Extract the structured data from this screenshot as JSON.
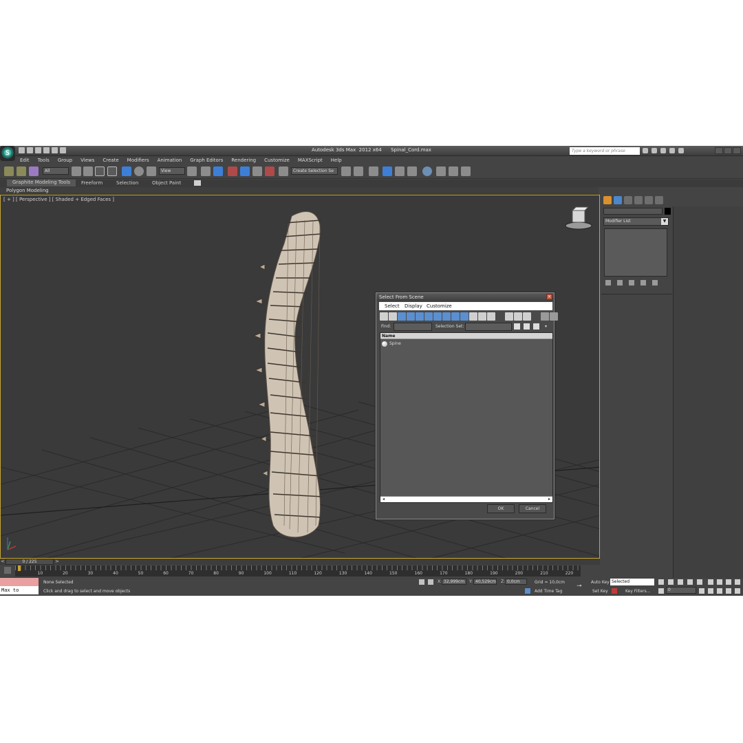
{
  "app": {
    "title": "Autodesk 3ds Max  2012 x64      Spinal_Cord.max",
    "logo_glyph": "S",
    "search_placeholder": "Type a keyword or phrase"
  },
  "menu": [
    "Edit",
    "Tools",
    "Group",
    "Views",
    "Create",
    "Modifiers",
    "Animation",
    "Graph Editors",
    "Rendering",
    "Customize",
    "MAXScript",
    "Help"
  ],
  "toolbar": {
    "selection_filter": "All",
    "reference_coord": "View",
    "named_selection_set": "Create Selection Se"
  },
  "ribbon": {
    "tabs": [
      "Graphite Modeling Tools",
      "Freeform",
      "Selection",
      "Object Paint"
    ],
    "active_tab": "Graphite Modeling Tools",
    "panel": "Polygon Modeling"
  },
  "viewport": {
    "label": "[ + ] [ Perspective ] [ Shaded + Edged Faces ]",
    "border_color": "#c9a532"
  },
  "command_panel": {
    "modifier_list": "Modifier List"
  },
  "dialog": {
    "title": "Select From Scene",
    "menu": [
      "Select",
      "Display",
      "Customize"
    ],
    "find_label": "Find:",
    "selection_set_label": "Selection Set:",
    "column_header": "Name",
    "rows": [
      "Spine"
    ],
    "ok_label": "OK",
    "cancel_label": "Cancel"
  },
  "timeline": {
    "frame_counter": "0 / 225",
    "ticks": [
      "10",
      "20",
      "30",
      "40",
      "50",
      "60",
      "70",
      "80",
      "90",
      "100",
      "110",
      "120",
      "130",
      "140",
      "150",
      "160",
      "170",
      "180",
      "190",
      "200",
      "210",
      "220"
    ]
  },
  "status": {
    "maxscript_label": "Max to Physc.",
    "selection_status": "None Selected",
    "prompt": "Click and drag to select and move objects",
    "x_label": "X:",
    "x_value": "32,999cm",
    "y_label": "Y:",
    "y_value": "40,529cm",
    "z_label": "Z:",
    "z_value": "0,0cm",
    "grid": "Grid = 10,0cm",
    "add_time_tag": "Add Time Tag",
    "auto_key": "Auto Key",
    "set_key": "Set Key",
    "key_mode": "Selected",
    "key_filters": "Key Filters...",
    "current_frame": "0"
  }
}
